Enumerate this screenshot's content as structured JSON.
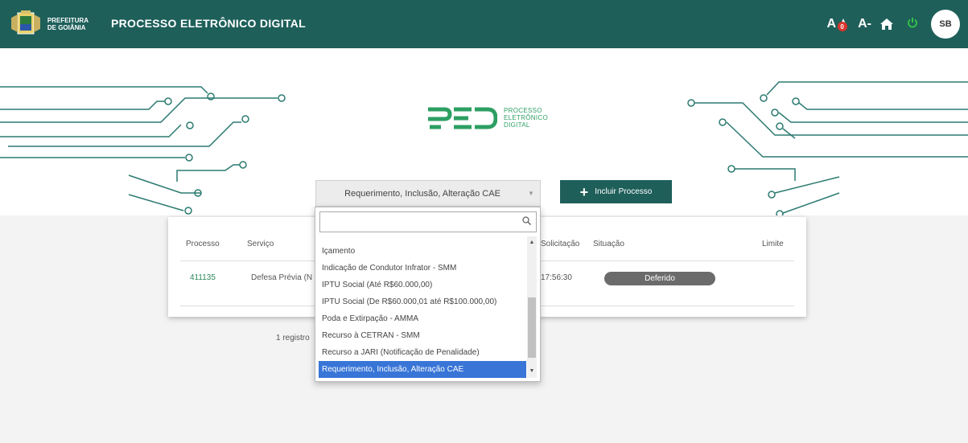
{
  "header": {
    "brand_line1": "PREFEITURA",
    "brand_line2": "DE GOIÂNIA",
    "title": "PROCESSO ELETRÔNICO DIGITAL",
    "font_increase": "A",
    "font_decrease": "A-",
    "notification_count": "0",
    "avatar_initials": "SB",
    "icons": [
      "font-size-icon",
      "home-icon",
      "power-icon"
    ]
  },
  "hero": {
    "logo_mark": "PED",
    "logo_line1": "PROCESSO",
    "logo_line2": "ELETRÔNICO",
    "logo_line3": "DIGITAL"
  },
  "service_select": {
    "value": "Requerimento, Inclusão, Alteração CAE",
    "search_placeholder": "",
    "options": [
      "Içamento",
      "Indicação de Condutor Infrator - SMM",
      "IPTU Social (Até R$60.000,00)",
      "IPTU Social (De R$60.000,01 até R$100.000,00)",
      "Poda e Extirpação - AMMA",
      "Recurso à CETRAN - SMM",
      "Recurso a JARI (Notificação de Penalidade)",
      "Requerimento, Inclusão, Alteração CAE"
    ],
    "selected_index": 7
  },
  "add_button": {
    "label": "Incluir Processo"
  },
  "table": {
    "headers": {
      "processo": "Processo",
      "servico": "Serviço",
      "solicitacao": "Solicitação",
      "situacao": "Situação",
      "limite": "Limite"
    },
    "row": {
      "processo": "411135",
      "servico": "Defesa Prévia (N",
      "solicitacao": "17:56:30",
      "situacao": "Deferido"
    }
  },
  "footer": {
    "records": "1 registro"
  },
  "colors": {
    "topbar": "#1e5f5a",
    "accent_green": "#2d9f63",
    "selected_option": "#3875d7",
    "status_pill": "#6b6b6b"
  }
}
